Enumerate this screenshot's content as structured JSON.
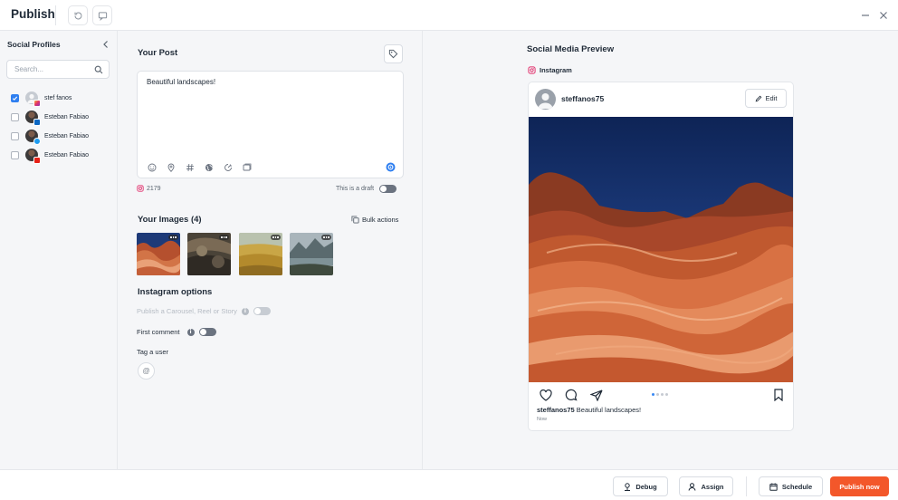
{
  "app": {
    "title": "Publish",
    "accent_color": "#f3572a",
    "checkbox_color": "#2f7ff0"
  },
  "sidebar": {
    "title": "Social Profiles",
    "search_placeholder": "Search...",
    "profiles": [
      {
        "name": "stef fanos",
        "checked": true,
        "network_icon": "instagram-icon"
      },
      {
        "name": "Esteban Fabiao",
        "checked": false,
        "network_icon": "linkedin-icon"
      },
      {
        "name": "Esteban Fabiao",
        "checked": false,
        "network_icon": "twitter-icon"
      },
      {
        "name": "Esteban Fabiao",
        "checked": false,
        "network_icon": "youtube-icon"
      }
    ]
  },
  "composer": {
    "title": "Your Post",
    "post_text": "Beautiful landscapes!",
    "toolbar_icons": [
      "emoji-icon",
      "location-icon",
      "hashtag-icon",
      "globe-icon",
      "gif-icon",
      "media-icon"
    ],
    "char_count": "2179",
    "draft_label": "This is a draft",
    "images_title": "Your Images (4)",
    "bulk_actions_label": "Bulk actions",
    "images": [
      {
        "name": "wave-canyon"
      },
      {
        "name": "rock-detail"
      },
      {
        "name": "golden-field"
      },
      {
        "name": "mountain-lake"
      }
    ],
    "options_title": "Instagram options",
    "carousel_option": "Publish a Carousel, Reel or Story",
    "first_comment_label": "First comment",
    "tag_user_label": "Tag a user",
    "at_symbol": "@"
  },
  "preview": {
    "title": "Social Media Preview",
    "network": "Instagram",
    "username": "steffanos75",
    "edit_label": "Edit",
    "caption_user": "steffanos75",
    "caption_text": " Beautiful landscapes!",
    "time": "Now"
  },
  "footer": {
    "debug_label": "Debug",
    "assign_label": "Assign",
    "schedule_label": "Schedule",
    "publish_label": "Publish now"
  }
}
